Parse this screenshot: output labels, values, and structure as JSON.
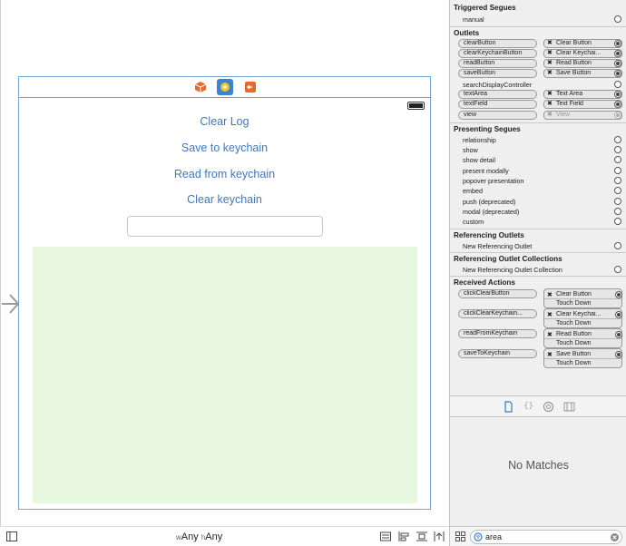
{
  "canvas": {
    "scene": {
      "buttons": {
        "clear_log": "Clear Log",
        "save_to_keychain": "Save to keychain",
        "read_from_keychain": "Read from keychain",
        "clear_keychain": "Clear keychain"
      },
      "text_field_value": "",
      "dock_icons": [
        "cube-icon",
        "view-controller-icon",
        "exit-icon"
      ]
    },
    "size_class": {
      "w_prefix": "w",
      "w_value": "Any",
      "h_prefix": "h",
      "h_value": "Any"
    }
  },
  "inspector": {
    "triggered_segues": {
      "title": "Triggered Segues",
      "items": [
        {
          "label": "manual"
        }
      ]
    },
    "outlets": {
      "title": "Outlets",
      "items": [
        {
          "name": "clearButton",
          "target": "Clear Button"
        },
        {
          "name": "clearKeychainButton",
          "target": "Clear Keychai..."
        },
        {
          "name": "readButton",
          "target": "Read Button"
        },
        {
          "name": "saveButton",
          "target": "Save Button"
        },
        {
          "name": "searchDisplayController",
          "target": ""
        },
        {
          "name": "textArea",
          "target": "Text Area"
        },
        {
          "name": "textField",
          "target": "Text Field"
        },
        {
          "name": "view",
          "target": "View"
        }
      ]
    },
    "presenting_segues": {
      "title": "Presenting Segues",
      "items": [
        "relationship",
        "show",
        "show detail",
        "present modally",
        "popover presentation",
        "embed",
        "push (deprecated)",
        "modal (deprecated)",
        "custom"
      ]
    },
    "referencing_outlets": {
      "title": "Referencing Outlets",
      "item": "New Referencing Outlet"
    },
    "referencing_outlet_collections": {
      "title": "Referencing Outlet Collections",
      "item": "New Referencing Outlet Collection"
    },
    "received_actions": {
      "title": "Received Actions",
      "items": [
        {
          "name": "clickClearButton",
          "target": "Clear Button",
          "event": "Touch Down"
        },
        {
          "name": "clickClearKeychain...",
          "target": "Clear Keychai...",
          "event": "Touch Down"
        },
        {
          "name": "readFromKeychain",
          "target": "Read Button",
          "event": "Touch Down"
        },
        {
          "name": "saveToKeychain",
          "target": "Save Button",
          "event": "Touch Down"
        }
      ]
    }
  },
  "library": {
    "tabs": [
      "file-template-icon",
      "code-snippet-icon",
      "object-library-icon",
      "media-library-icon"
    ],
    "empty_message": "No Matches",
    "filter_value": "area"
  },
  "colors": {
    "accent": "#3f77c1",
    "text_area_bg": "#e8f8e0",
    "scene_border": "#7aa3d1",
    "dock_orange": "#e8692c",
    "dock_yellow": "#f3c129"
  }
}
